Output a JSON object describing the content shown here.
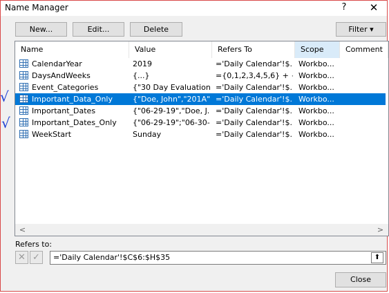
{
  "window": {
    "title": "Name Manager",
    "help_glyph": "?",
    "close_glyph": "✕"
  },
  "toolbar": {
    "new_label": "New...",
    "edit_label": "Edit...",
    "delete_label": "Delete",
    "filter_label": "Filter",
    "filter_arrow": "▾"
  },
  "columns": {
    "name": "Name",
    "value": "Value",
    "refers_to": "Refers To",
    "scope": "Scope",
    "comment": "Comment"
  },
  "rows": [
    {
      "name": "CalendarYear",
      "value": "2019",
      "refers_to": "='Daily Calendar'!$...",
      "scope": "Workbo..."
    },
    {
      "name": "DaysAndWeeks",
      "value": "{...}",
      "refers_to": "={0,1,2,3,4,5,6} + {0...",
      "scope": "Workbo..."
    },
    {
      "name": "Event_Categories",
      "value": "{\"30 Day Evaluation...",
      "refers_to": "='Daily Calendar'!$...",
      "scope": "Workbo..."
    },
    {
      "name": "Important_Data_Only",
      "value": "{\"Doe, John\",\"201A\"...",
      "refers_to": "='Daily Calendar'!$...",
      "scope": "Workbo...",
      "selected": true
    },
    {
      "name": "Important_Dates",
      "value": "{\"06-29-19\",\"Doe, J...",
      "refers_to": "='Daily Calendar'!$...",
      "scope": "Workbo..."
    },
    {
      "name": "Important_Dates_Only",
      "value": "{\"06-29-19\";\"06-30-...",
      "refers_to": "='Daily Calendar'!$...",
      "scope": "Workbo..."
    },
    {
      "name": "WeekStart",
      "value": "Sunday",
      "refers_to": "='Daily Calendar'!$...",
      "scope": "Workbo..."
    }
  ],
  "scrollbar": {
    "left_arrow": "<",
    "right_arrow": ">"
  },
  "refers": {
    "label": "Refers to:",
    "value": "='Daily Calendar'!$C$6:$H$35",
    "cancel_glyph": "✕",
    "confirm_glyph": "✓",
    "collapse_glyph": "⬆"
  },
  "footer": {
    "close_label": "Close"
  },
  "annotations": {
    "mark1": "√",
    "mark2": "√"
  },
  "colors": {
    "selection": "#0078d7",
    "sorted_header": "#d9ebf9",
    "annotation_ink": "#1c3fd4",
    "window_border": "#d94848"
  }
}
